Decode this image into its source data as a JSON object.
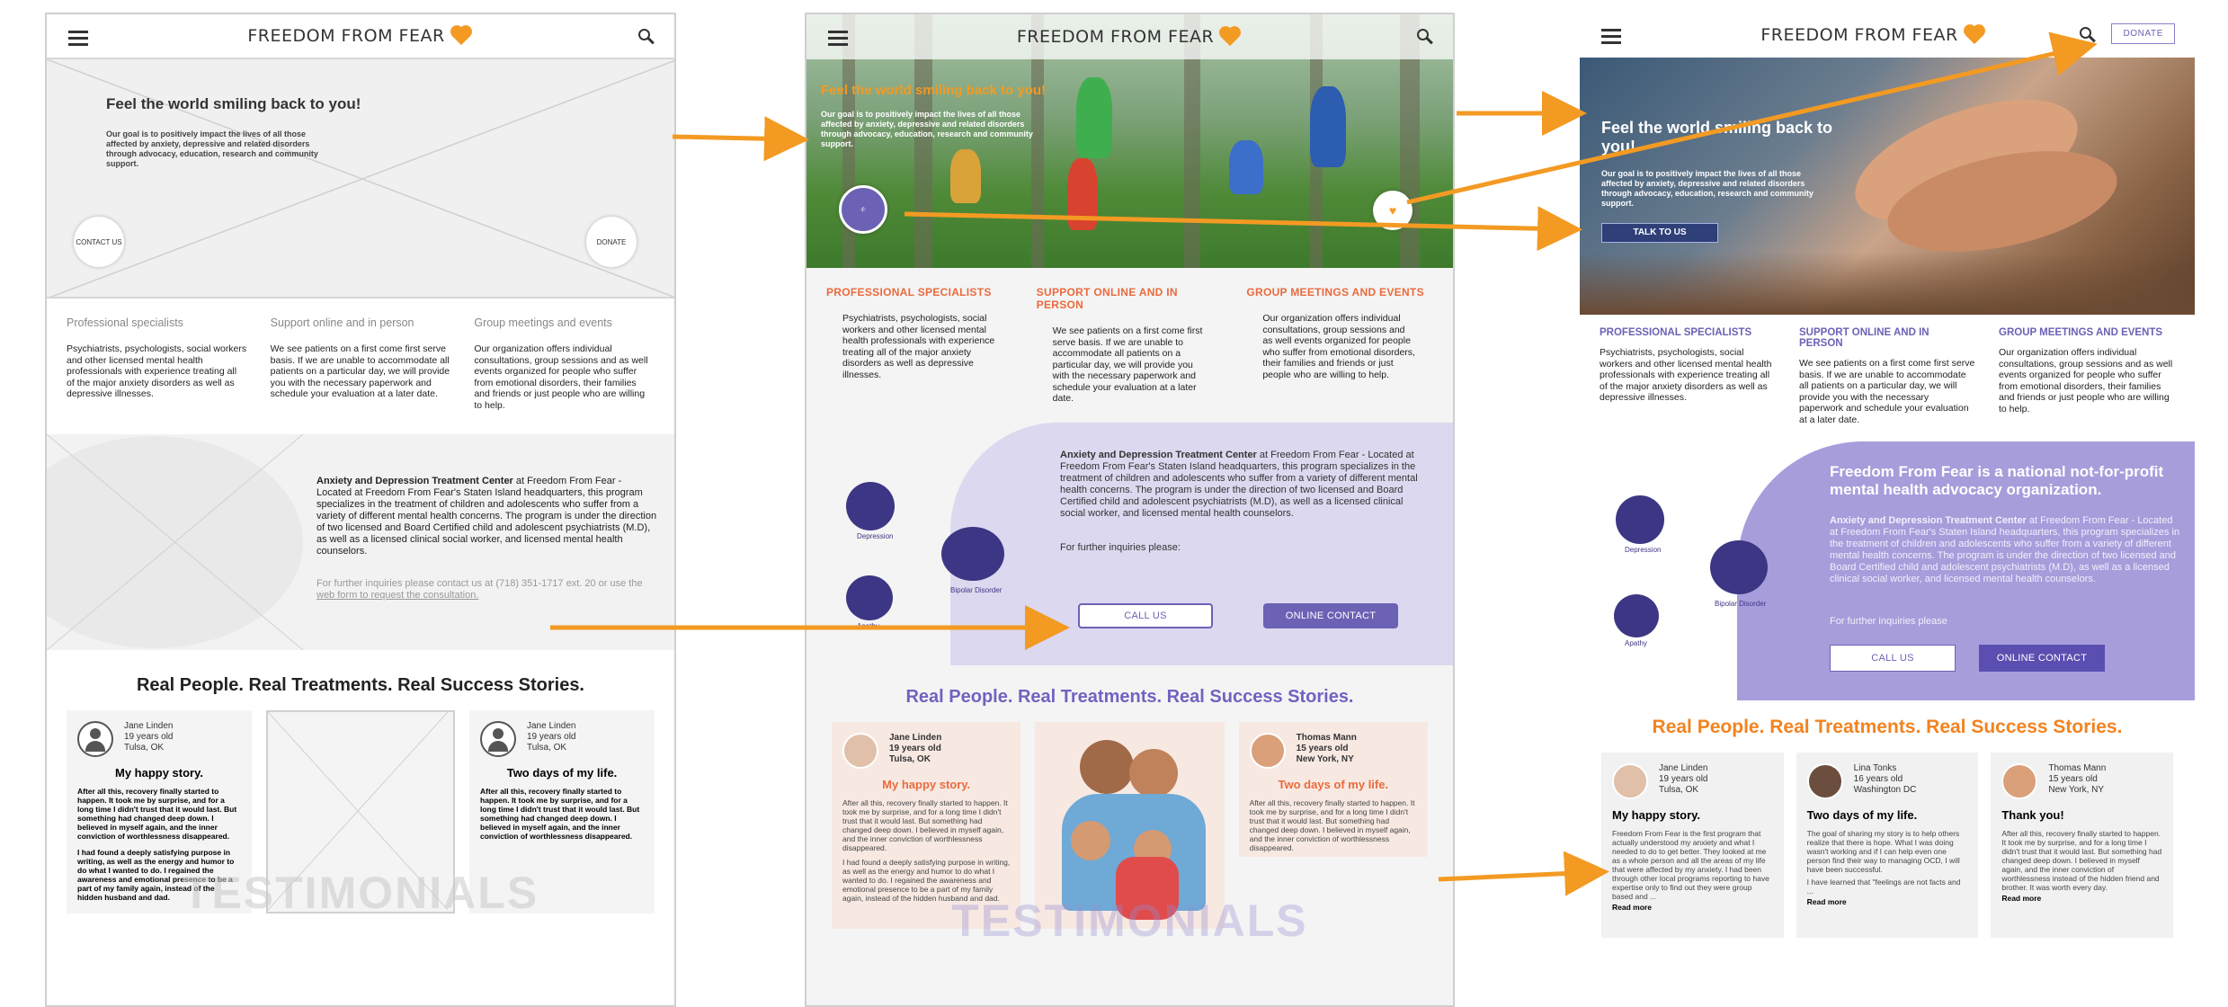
{
  "brand": {
    "name": "FREEDOM FROM FEAR",
    "accent": "#f39a23",
    "purple": "#6b62b5",
    "orange_heading": "#ea6a3c"
  },
  "hero": {
    "title": "Feel the world smiling back to you!",
    "text": "Our goal is to positively impact the lives of all those affected by anxiety, depressive and related disorders through advocacy, education, research and community support.",
    "contact_label": "CONTACT US",
    "donate_label": "DONATE",
    "talk_label": "TALK TO US"
  },
  "features": [
    {
      "title": "Professional specialists",
      "title_caps": "PROFESSIONAL SPECIALISTS",
      "text": "Psychiatrists, psychologists, social workers and other licensed mental health professionals with experience treating all of the major anxiety disorders as well as depressive illnesses."
    },
    {
      "title": "Support online and in person",
      "title_caps": "SUPPORT ONLINE AND IN PERSON",
      "text": "We see patients on a first come first serve basis. If we are unable to accommodate all patients on a particular day, we will provide you with the necessary paperwork and schedule your evaluation at a later date."
    },
    {
      "title": "Group meetings and events",
      "title_caps": "GROUP MEETINGS AND EVENTS",
      "text": "Our organization offers individual consultations, group sessions and as well events organized for people who suffer from emotional disorders, their families and friends or just people who are willing to help."
    }
  ],
  "treatment": {
    "title": "Anxiety and Depression Treatment Center",
    "body": " at Freedom From Fear - Located at Freedom From Fear's Staten Island headquarters, this program specializes in the treatment of children and adolescents who suffer from a variety of different mental health concerns. The program is under the direction of two licensed and Board Certified child and adolescent psychiatrists (M.D), as well as a licensed clinical social worker, and licensed mental health counselors.",
    "wire_inquiry": "For further inquiries please contact us at (718) 351-1717 ext. 20 or use the ",
    "wire_link": "web form to request the consultation.",
    "inquiry": "For further inquiries please:",
    "inquiry_v3": "For further inquiries please",
    "call_label": "CALL US",
    "online_label": "ONLINE CONTACT",
    "headline": "Freedom From Fear is a national not-for-profit mental health advocacy organization.",
    "blobs": [
      "Depression",
      "Bipolar Disorder",
      "Apathy"
    ]
  },
  "stories": {
    "heading": "Real People. Real Treatments. Real Success Stories.",
    "watermark": "TESTIMONIALS",
    "read_more": "Read more",
    "wire_cards": [
      {
        "name": "Jane Linden",
        "age": "19 years old",
        "city": "Tulsa, OK",
        "title": "My happy story.",
        "p1": "After all this, recovery finally started to happen. It took me by surprise, and for a long time I didn't trust that it would last. But something had changed deep down. I believed in myself again, and the inner conviction of worthlessness disappeared.",
        "p2": "I had found a deeply satisfying purpose in writing, as well as the energy and humor to do what I wanted to do. I regained the awareness and emotional presence to be a part of my family again, instead of the hidden husband and dad."
      },
      {
        "name": "Jane Linden",
        "age": "19 years old",
        "city": "Tulsa, OK",
        "title": "Two days of my life.",
        "p1": "After all this, recovery finally started to happen. It took me by surprise, and for a long time I didn't trust that it would last. But something had changed deep down. I believed in myself again, and the inner conviction of worthlessness disappeared."
      }
    ],
    "v2_cards": [
      {
        "name": "Jane Linden",
        "age": "19 years old",
        "city": "Tulsa, OK",
        "title": "My happy story.",
        "p1": "After all this, recovery finally started to happen. It took me by surprise, and for a long time I didn't trust that it would last. But something had changed deep down. I believed in myself again, and the inner conviction of worthlessness disappeared.",
        "p2": "I had found a deeply satisfying purpose in writing, as well as the energy and humor to do what I wanted to do. I regained the awareness and emotional presence to be a part of my family again, instead of the hidden husband and dad."
      },
      {
        "name": "Thomas Mann",
        "age": "15 years old",
        "city": "New York, NY",
        "title": "Two days of my life.",
        "p1": "After all this, recovery finally started to happen. It took me by surprise, and for a long time I didn't trust that it would last. But something had changed deep down. I believed in myself again, and the inner conviction of worthlessness disappeared."
      }
    ],
    "v3_cards": [
      {
        "name": "Jane Linden",
        "age": "19 years old",
        "city": "Tulsa, OK",
        "title": "My happy story.",
        "p1": "Freedom From Fear is the first program that actually understood my anxiety and what I needed to do to get better. They looked at me as a whole person and all the areas of my life that were affected by my anxiety. I had been through other local programs reporting to have expertise only to find out they were group based and ..."
      },
      {
        "name": "Lina Tonks",
        "age": "16 years old",
        "city": "Washington DC",
        "title": "Two days of my life.",
        "p1": "The goal of sharing my story is to help others realize that there is hope. What I was doing wasn't working and if I can help even one person find their way to managing OCD, I will have been successful.",
        "p2": "I have learned that \"feelings are not facts and ..."
      },
      {
        "name": "Thomas Mann",
        "age": "15 years old",
        "city": "New York, NY",
        "title": "Thank you!",
        "p1": "After all this, recovery finally started to happen. It took me by surprise, and for a long time I didn't trust that it would last. But something had changed deep down. I believed in myself again, and the inner conviction of worthlessness instead of the hidden friend and brother. It was worth every day."
      }
    ]
  }
}
